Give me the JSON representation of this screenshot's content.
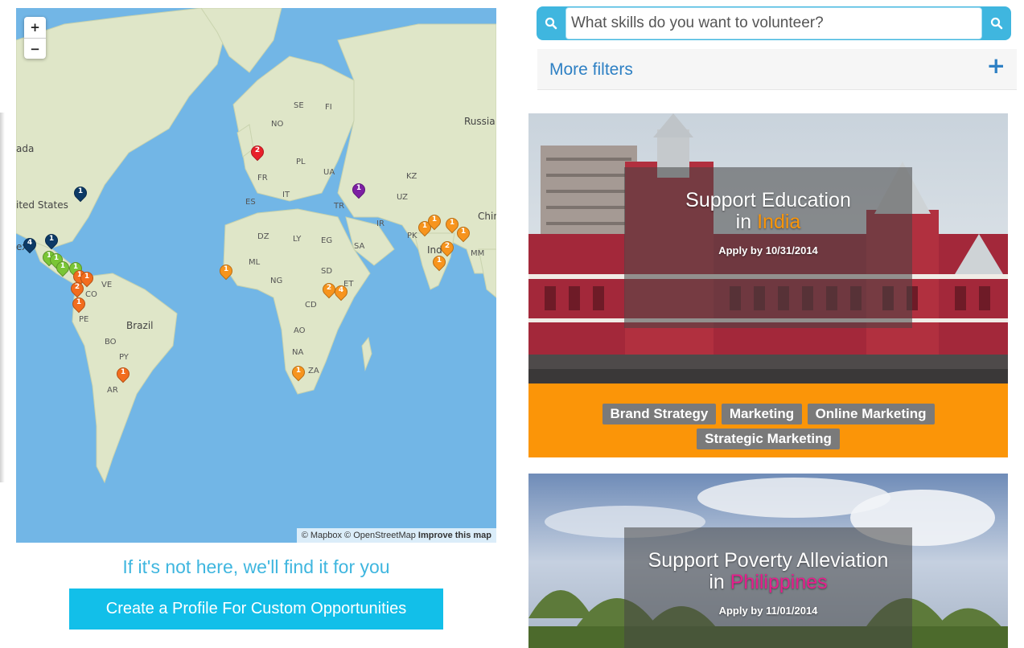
{
  "map": {
    "zoom_in": "+",
    "zoom_out": "−",
    "attribution": "© Mapbox © OpenStreetMap",
    "attribution_link": "Improve this map",
    "labels": {
      "russia": "Russia",
      "canada": "ada",
      "united_states": "ited States",
      "mexico": "ex",
      "brazil": "Brazil",
      "se": "SE",
      "no": "NO",
      "fi": "FI",
      "pl": "PL",
      "ua": "UA",
      "fr": "FR",
      "es": "ES",
      "it": "IT",
      "tr": "TR",
      "kz": "KZ",
      "uz": "UZ",
      "ir": "IR",
      "dz": "DZ",
      "ly": "LY",
      "eg": "EG",
      "sa": "SA",
      "ml": "ML",
      "ng": "NG",
      "sd": "SD",
      "et": "ET",
      "cd": "CD",
      "ao": "AO",
      "na": "NA",
      "za": "ZA",
      "pk": "PK",
      "india": "Ind",
      "mm": "MM",
      "china": "Chin",
      "ve": "VE",
      "co": "CO",
      "pe": "PE",
      "bo": "BO",
      "py": "PY",
      "ar": "AR"
    },
    "markers": [
      {
        "num": "2",
        "color": "#e8202a"
      },
      {
        "num": "1",
        "color": "#7d1fa3"
      },
      {
        "num": "1",
        "color": "#0d3a66"
      },
      {
        "num": "4",
        "color": "#0d3a66"
      },
      {
        "num": "1",
        "color": "#0d3a66"
      },
      {
        "num": "1",
        "color": "#7ac536"
      },
      {
        "num": "1",
        "color": "#7ac536"
      },
      {
        "num": "1",
        "color": "#7ac536"
      },
      {
        "num": "1",
        "color": "#7ac536"
      },
      {
        "num": "1",
        "color": "#f26c1e"
      },
      {
        "num": "1",
        "color": "#f26c1e"
      },
      {
        "num": "2",
        "color": "#f26c1e"
      },
      {
        "num": "1",
        "color": "#f26c1e"
      },
      {
        "num": "1",
        "color": "#f26c1e"
      },
      {
        "num": "1",
        "color": "#f7941d"
      },
      {
        "num": "2",
        "color": "#f7941d"
      },
      {
        "num": "4",
        "color": "#f7941d"
      },
      {
        "num": "1",
        "color": "#f7941d"
      },
      {
        "num": "1",
        "color": "#f7941d"
      },
      {
        "num": "1",
        "color": "#f7941d"
      },
      {
        "num": "1",
        "color": "#f7941d"
      },
      {
        "num": "1",
        "color": "#f7941d"
      },
      {
        "num": "2",
        "color": "#f7941d"
      },
      {
        "num": "1",
        "color": "#f7941d"
      }
    ]
  },
  "find_text": "If it's not here, we'll find it for you",
  "create_button": "Create a Profile For Custom Opportunities",
  "search": {
    "placeholder": "What skills do you want to volunteer?",
    "left_icon": "search-icon",
    "right_icon": "search-icon"
  },
  "filters": {
    "label": "More filters",
    "toggle": "+"
  },
  "cards": [
    {
      "title": "Support Education",
      "in": "in",
      "country": "India",
      "country_color": "#fb9508",
      "apply": "Apply by 10/31/2014",
      "skills": [
        "Brand Strategy",
        "Marketing",
        "Online Marketing",
        "Strategic Marketing"
      ]
    },
    {
      "title": "Support Poverty Alleviation",
      "in": "in",
      "country": "Philippines",
      "country_color": "#e61e8c",
      "apply": "Apply by 11/01/2014"
    }
  ],
  "colors": {
    "accent": "#3fb6df",
    "button": "#12bfe9",
    "link": "#2e80c4",
    "skills_bar": "#fb9508",
    "tag": "#7a7a7a"
  }
}
